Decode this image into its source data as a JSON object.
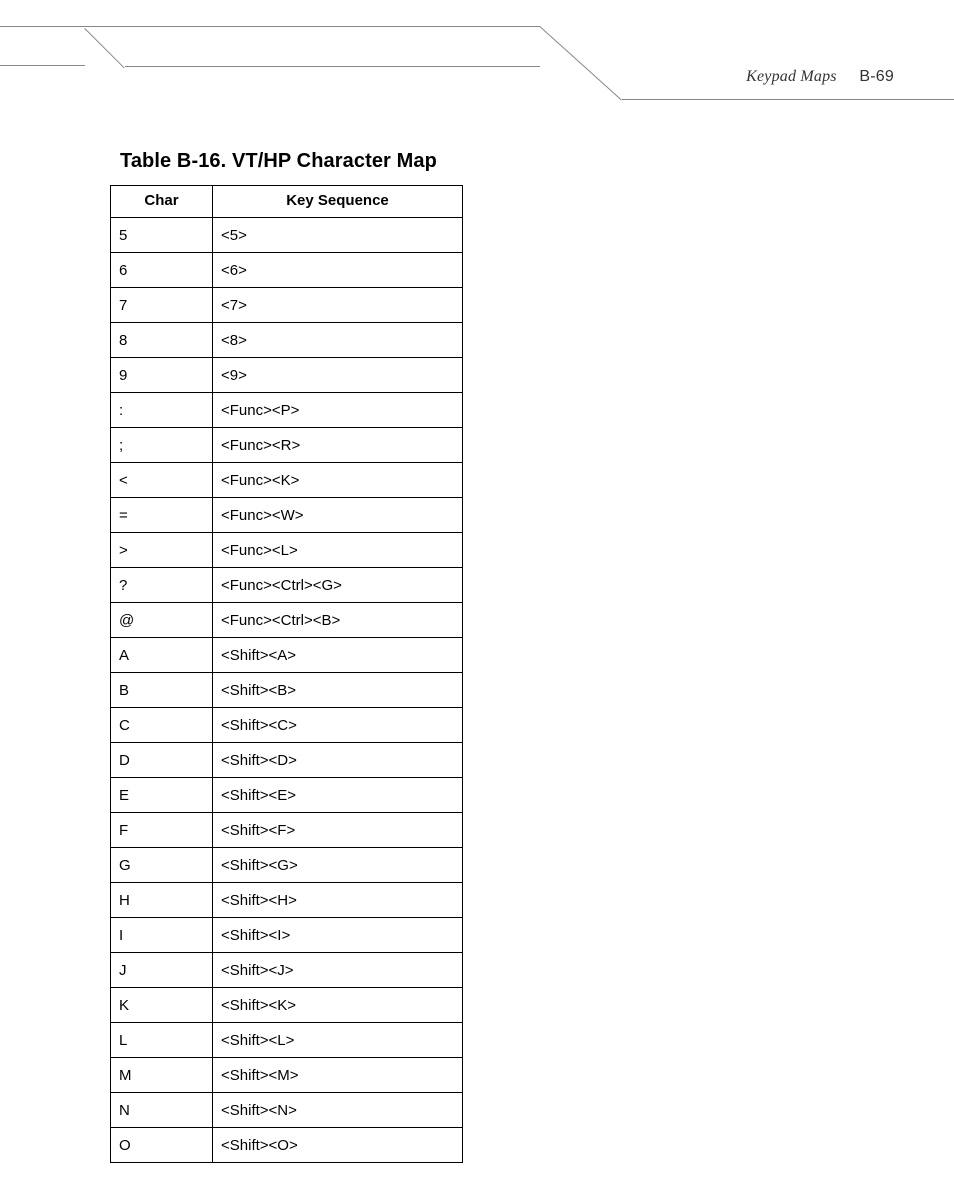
{
  "header": {
    "section": "Keypad Maps",
    "page_number": "B-69"
  },
  "table": {
    "title": "Table B-16. VT/HP Character Map",
    "columns": [
      "Char",
      "Key Sequence"
    ],
    "rows": [
      {
        "char": "5",
        "seq": "<5>"
      },
      {
        "char": "6",
        "seq": "<6>"
      },
      {
        "char": "7",
        "seq": "<7>"
      },
      {
        "char": "8",
        "seq": "<8>"
      },
      {
        "char": "9",
        "seq": "<9>"
      },
      {
        "char": ":",
        "seq": "<Func><P>"
      },
      {
        "char": ";",
        "seq": "<Func><R>"
      },
      {
        "char": "<",
        "seq": "<Func><K>"
      },
      {
        "char": "=",
        "seq": "<Func><W>"
      },
      {
        "char": ">",
        "seq": "<Func><L>"
      },
      {
        "char": "?",
        "seq": "<Func><Ctrl><G>"
      },
      {
        "char": "@",
        "seq": "<Func><Ctrl><B>"
      },
      {
        "char": "A",
        "seq": "<Shift><A>"
      },
      {
        "char": "B",
        "seq": "<Shift><B>"
      },
      {
        "char": "C",
        "seq": "<Shift><C>"
      },
      {
        "char": "D",
        "seq": "<Shift><D>"
      },
      {
        "char": "E",
        "seq": "<Shift><E>"
      },
      {
        "char": "F",
        "seq": "<Shift><F>"
      },
      {
        "char": "G",
        "seq": "<Shift><G>"
      },
      {
        "char": "H",
        "seq": "<Shift><H>"
      },
      {
        "char": "I",
        "seq": "<Shift><I>"
      },
      {
        "char": "J",
        "seq": "<Shift><J>"
      },
      {
        "char": "K",
        "seq": "<Shift><K>"
      },
      {
        "char": "L",
        "seq": "<Shift><L>"
      },
      {
        "char": "M",
        "seq": "<Shift><M>"
      },
      {
        "char": "N",
        "seq": "<Shift><N>"
      },
      {
        "char": "O",
        "seq": "<Shift><O>"
      }
    ]
  }
}
